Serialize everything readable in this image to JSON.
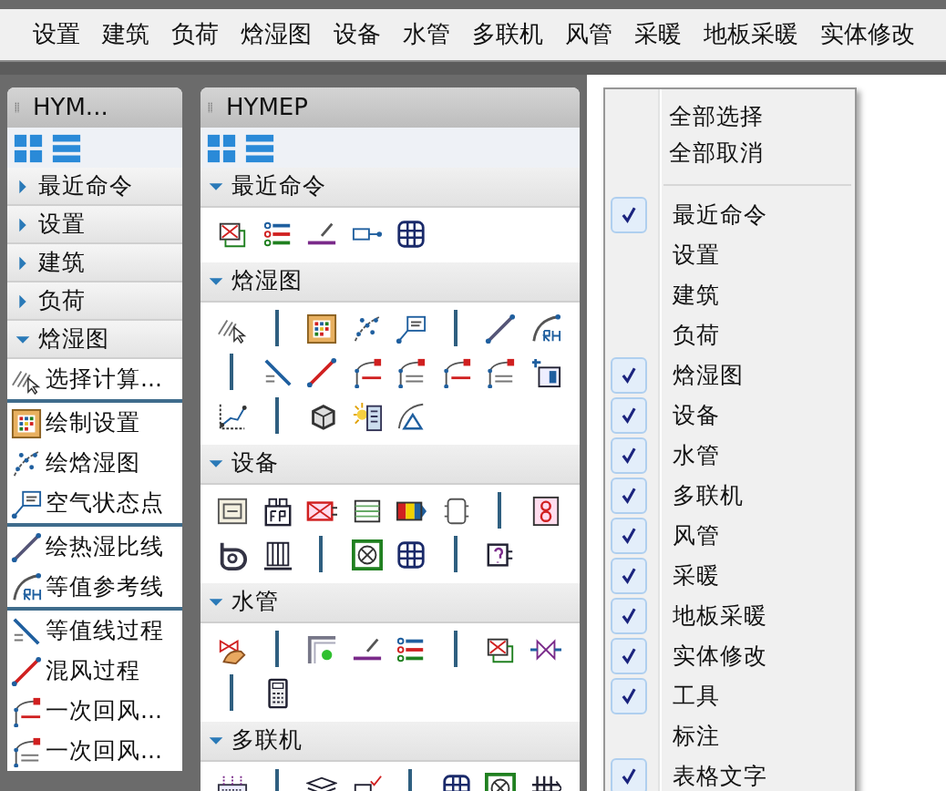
{
  "menu_bar": {
    "items": [
      "设置",
      "建筑",
      "负荷",
      "焓湿图",
      "设备",
      "水管",
      "多联机",
      "风管",
      "采暖",
      "地板采暖",
      "实体修改"
    ]
  },
  "left_panel": {
    "title": "HYM...",
    "categories": [
      {
        "label": "最近命令",
        "expanded": false
      },
      {
        "label": "设置",
        "expanded": false
      },
      {
        "label": "建筑",
        "expanded": false
      },
      {
        "label": "负荷",
        "expanded": false
      },
      {
        "label": "焓湿图",
        "expanded": true,
        "groups": [
          [
            "选择计算..."
          ],
          [
            "绘制设置",
            "绘焓湿图",
            "空气状态点"
          ],
          [
            "绘热湿比线",
            "等值参考线"
          ],
          [
            "等值线过程",
            "混风过程",
            "一次回风...",
            "一次回风..."
          ]
        ]
      }
    ]
  },
  "main_panel": {
    "title": "HYMEP",
    "sections": [
      {
        "title": "最近命令",
        "expanded": true
      },
      {
        "title": "焓湿图",
        "expanded": true
      },
      {
        "title": "设备",
        "expanded": true
      },
      {
        "title": "水管",
        "expanded": true
      },
      {
        "title": "多联机",
        "expanded": true
      }
    ]
  },
  "context_menu": {
    "actions": [
      "全部选择",
      "全部取消"
    ],
    "items": [
      {
        "label": "最近命令",
        "checked": true
      },
      {
        "label": "设置",
        "checked": false
      },
      {
        "label": "建筑",
        "checked": false
      },
      {
        "label": "负荷",
        "checked": false
      },
      {
        "label": "焓湿图",
        "checked": true
      },
      {
        "label": "设备",
        "checked": true
      },
      {
        "label": "水管",
        "checked": true
      },
      {
        "label": "多联机",
        "checked": true
      },
      {
        "label": "风管",
        "checked": true
      },
      {
        "label": "采暖",
        "checked": true
      },
      {
        "label": "地板采暖",
        "checked": true
      },
      {
        "label": "实体修改",
        "checked": true
      },
      {
        "label": "工具",
        "checked": true
      },
      {
        "label": "标注",
        "checked": false
      },
      {
        "label": "表格文字",
        "checked": true
      }
    ]
  }
}
